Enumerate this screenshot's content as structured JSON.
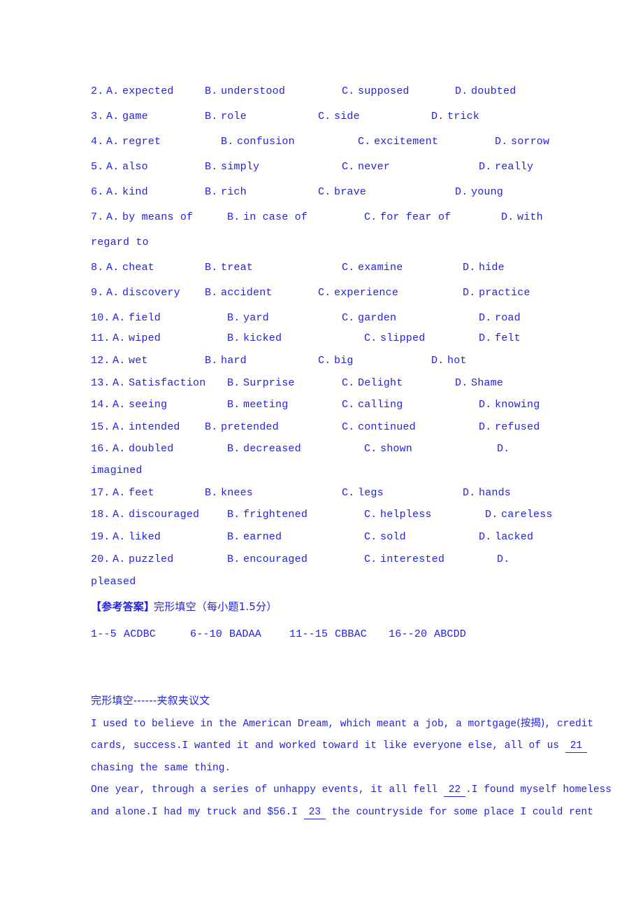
{
  "document": {
    "text_color": "#2222dd",
    "background_color": "#ffffff"
  },
  "questions": [
    {
      "number": "2.",
      "options": [
        {
          "letter": "A.",
          "text": "expected"
        },
        {
          "letter": "B.",
          "text": "understood"
        },
        {
          "letter": "C.",
          "text": "supposed"
        },
        {
          "letter": "D.",
          "text": "doubted"
        }
      ]
    },
    {
      "number": "3.",
      "options": [
        {
          "letter": "A.",
          "text": "game"
        },
        {
          "letter": "B.",
          "text": "role"
        },
        {
          "letter": "C.",
          "text": "side"
        },
        {
          "letter": "D.",
          "text": "trick"
        }
      ]
    },
    {
      "number": "4.",
      "options": [
        {
          "letter": "A.",
          "text": "regret"
        },
        {
          "letter": "B.",
          "text": "confusion"
        },
        {
          "letter": "C.",
          "text": "excitement"
        },
        {
          "letter": "D.",
          "text": "sorrow"
        }
      ]
    },
    {
      "number": "5.",
      "options": [
        {
          "letter": "A.",
          "text": "also"
        },
        {
          "letter": "B.",
          "text": "simply"
        },
        {
          "letter": "C.",
          "text": "never"
        },
        {
          "letter": "D.",
          "text": "really"
        }
      ]
    },
    {
      "number": "6.",
      "options": [
        {
          "letter": "A.",
          "text": "kind"
        },
        {
          "letter": "B.",
          "text": "rich"
        },
        {
          "letter": "C.",
          "text": "brave"
        },
        {
          "letter": "D.",
          "text": "young"
        }
      ]
    },
    {
      "number": "7.",
      "options": [
        {
          "letter": "A.",
          "text": "by means of"
        },
        {
          "letter": "B.",
          "text": "in case of"
        },
        {
          "letter": "C.",
          "text": "for fear of"
        },
        {
          "letter": "D.",
          "text": "with"
        }
      ],
      "wrapped_tail": "regard to"
    },
    {
      "number": "8.",
      "options": [
        {
          "letter": "A.",
          "text": "cheat"
        },
        {
          "letter": "B.",
          "text": "treat"
        },
        {
          "letter": "C.",
          "text": "examine"
        },
        {
          "letter": "D.",
          "text": "hide"
        }
      ]
    },
    {
      "number": "9.",
      "options": [
        {
          "letter": "A.",
          "text": "discovery"
        },
        {
          "letter": "B.",
          "text": "accident"
        },
        {
          "letter": "C.",
          "text": "experience"
        },
        {
          "letter": "D.",
          "text": "practice"
        }
      ]
    },
    {
      "number": "10.",
      "options": [
        {
          "letter": "A.",
          "text": "field"
        },
        {
          "letter": "B.",
          "text": "yard"
        },
        {
          "letter": "C.",
          "text": "garden"
        },
        {
          "letter": "D.",
          "text": "road"
        }
      ]
    },
    {
      "number": "11.",
      "options": [
        {
          "letter": "A.",
          "text": "wiped"
        },
        {
          "letter": "B.",
          "text": "kicked"
        },
        {
          "letter": "C.",
          "text": "slipped"
        },
        {
          "letter": "D.",
          "text": "felt"
        }
      ]
    },
    {
      "number": "12.",
      "options": [
        {
          "letter": "A.",
          "text": "wet"
        },
        {
          "letter": "B.",
          "text": "hard"
        },
        {
          "letter": "C.",
          "text": "big"
        },
        {
          "letter": "D.",
          "text": "hot"
        }
      ]
    },
    {
      "number": "13.",
      "options": [
        {
          "letter": "A.",
          "text": "Satisfaction"
        },
        {
          "letter": "B.",
          "text": "Surprise"
        },
        {
          "letter": "C.",
          "text": "Delight"
        },
        {
          "letter": "D.",
          "text": "Shame"
        }
      ]
    },
    {
      "number": "14.",
      "options": [
        {
          "letter": "A.",
          "text": "seeing"
        },
        {
          "letter": "B.",
          "text": "meeting"
        },
        {
          "letter": "C.",
          "text": "calling"
        },
        {
          "letter": "D.",
          "text": "knowing"
        }
      ]
    },
    {
      "number": "15.",
      "options": [
        {
          "letter": "A.",
          "text": "intended"
        },
        {
          "letter": "B.",
          "text": "pretended"
        },
        {
          "letter": "C.",
          "text": "continued"
        },
        {
          "letter": "D.",
          "text": "refused"
        }
      ]
    },
    {
      "number": "16.",
      "options": [
        {
          "letter": "A.",
          "text": "doubled"
        },
        {
          "letter": "B.",
          "text": "decreased"
        },
        {
          "letter": "C.",
          "text": "shown"
        },
        {
          "letter": "D.",
          "text": ""
        }
      ],
      "wrapped_tail": "imagined"
    },
    {
      "number": "17.",
      "options": [
        {
          "letter": "A.",
          "text": "feet"
        },
        {
          "letter": "B.",
          "text": "knees"
        },
        {
          "letter": "C.",
          "text": "legs"
        },
        {
          "letter": "D.",
          "text": "hands"
        }
      ]
    },
    {
      "number": "18.",
      "options": [
        {
          "letter": "A.",
          "text": "discouraged"
        },
        {
          "letter": "B.",
          "text": "frightened"
        },
        {
          "letter": "C.",
          "text": "helpless"
        },
        {
          "letter": "D.",
          "text": "careless"
        }
      ]
    },
    {
      "number": "19.",
      "options": [
        {
          "letter": "A.",
          "text": "liked"
        },
        {
          "letter": "B.",
          "text": "earned"
        },
        {
          "letter": "C.",
          "text": "sold"
        },
        {
          "letter": "D.",
          "text": "lacked"
        }
      ]
    },
    {
      "number": "20.",
      "options": [
        {
          "letter": "A.",
          "text": "puzzled"
        },
        {
          "letter": "B.",
          "text": "encouraged"
        },
        {
          "letter": "C.",
          "text": "interested"
        },
        {
          "letter": "D.",
          "text": ""
        }
      ],
      "wrapped_tail": "pleased"
    }
  ],
  "answer_key": {
    "label_bracket": "【参考答案】",
    "label_rest": "完形填空（每小题1.5分）",
    "groups": [
      {
        "range": "1--5",
        "answers": "ACDBC"
      },
      {
        "range": "6--10",
        "answers": "BADAA"
      },
      {
        "range": "11--15",
        "answers": "CBBAC"
      },
      {
        "range": "16--20",
        "answers": "ABCDD"
      }
    ]
  },
  "new_section": {
    "heading": "完形填空------夹叙夹议文",
    "line1_a": "I used to believe in the American Dream, which meant a job, a mortgage",
    "line1_cn": "(按揭)",
    "line1_b": ", credit",
    "line2_a": "cards, success.I wanted it and worked toward it like everyone else, all of us ",
    "line2_blank": "21",
    "line3": "chasing the same thing.",
    "line4_a": "One year, through a series of unhappy events, it all fell ",
    "line4_blank": "22",
    "line4_b": ".I found myself homeless",
    "line5_a": "and alone.I had my truck and $56.I ",
    "line5_blank": "23",
    "line5_b": " the countryside for some place I could rent"
  }
}
